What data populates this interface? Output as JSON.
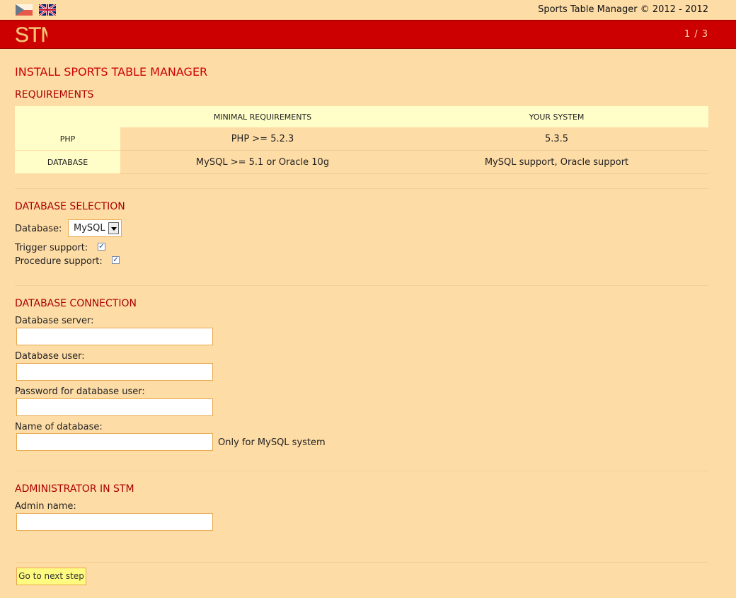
{
  "header": {
    "languages": [
      {
        "name": "czech-flag-icon"
      },
      {
        "name": "uk-flag-icon"
      }
    ],
    "copyright": "Sports Table Manager © 2012 - 2012",
    "logo_text": "STM",
    "page_counter": "1 / 3"
  },
  "colors": {
    "background": "#fedca6",
    "red_bar": "#cc0000",
    "heading_red": "#cc0000",
    "table_head_bg": "#fffec8",
    "button_bg": "#fffb80"
  },
  "main": {
    "title": "INSTALL SPORTS TABLE MANAGER",
    "requirements": {
      "heading": "REQUIREMENTS",
      "columns": [
        "",
        "MINIMAL REQUIREMENTS",
        "YOUR SYSTEM"
      ],
      "rows": [
        {
          "label": "PHP",
          "minimal": "PHP >= 5.2.3",
          "system": "5.3.5"
        },
        {
          "label": "DATABASE",
          "minimal": "MySQL >= 5.1 or Oracle 10g",
          "system": "MySQL support, Oracle support"
        }
      ]
    },
    "db_selection": {
      "heading": "DATABASE SELECTION",
      "database_label": "Database:",
      "database_value": "MySQL",
      "trigger_label": "Trigger support:",
      "trigger_checked": true,
      "procedure_label": "Procedure support:",
      "procedure_checked": true
    },
    "db_connection": {
      "heading": "DATABASE CONNECTION",
      "server_label": "Database server:",
      "server_value": "",
      "user_label": "Database user:",
      "user_value": "",
      "password_label": "Password for database user:",
      "password_value": "",
      "dbname_label": "Name of database:",
      "dbname_value": "",
      "dbname_hint": "Only for MySQL system"
    },
    "admin": {
      "heading": "ADMINISTRATOR IN STM",
      "name_label": "Admin name:",
      "name_value": ""
    },
    "next_button": "Go to next step"
  }
}
